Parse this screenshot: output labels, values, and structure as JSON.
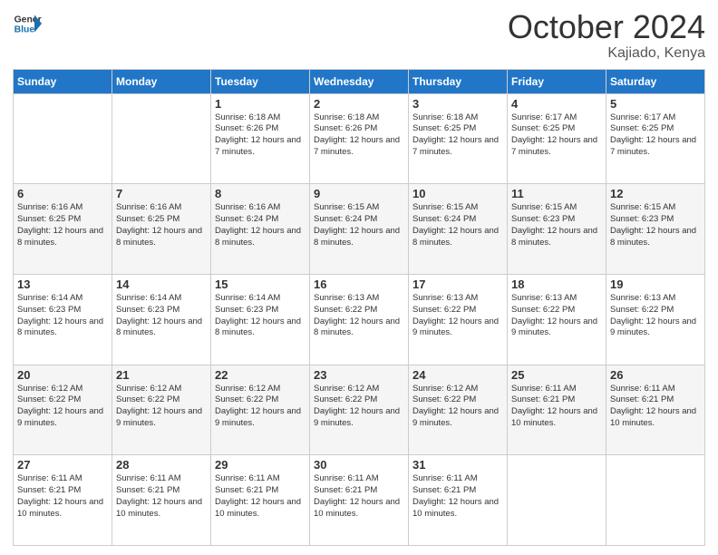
{
  "header": {
    "logo_line1": "General",
    "logo_line2": "Blue",
    "month": "October 2024",
    "location": "Kajiado, Kenya"
  },
  "weekdays": [
    "Sunday",
    "Monday",
    "Tuesday",
    "Wednesday",
    "Thursday",
    "Friday",
    "Saturday"
  ],
  "weeks": [
    [
      {
        "day": "",
        "info": ""
      },
      {
        "day": "",
        "info": ""
      },
      {
        "day": "1",
        "info": "Sunrise: 6:18 AM\nSunset: 6:26 PM\nDaylight: 12 hours and 7 minutes."
      },
      {
        "day": "2",
        "info": "Sunrise: 6:18 AM\nSunset: 6:26 PM\nDaylight: 12 hours and 7 minutes."
      },
      {
        "day": "3",
        "info": "Sunrise: 6:18 AM\nSunset: 6:25 PM\nDaylight: 12 hours and 7 minutes."
      },
      {
        "day": "4",
        "info": "Sunrise: 6:17 AM\nSunset: 6:25 PM\nDaylight: 12 hours and 7 minutes."
      },
      {
        "day": "5",
        "info": "Sunrise: 6:17 AM\nSunset: 6:25 PM\nDaylight: 12 hours and 7 minutes."
      }
    ],
    [
      {
        "day": "6",
        "info": "Sunrise: 6:16 AM\nSunset: 6:25 PM\nDaylight: 12 hours and 8 minutes."
      },
      {
        "day": "7",
        "info": "Sunrise: 6:16 AM\nSunset: 6:25 PM\nDaylight: 12 hours and 8 minutes."
      },
      {
        "day": "8",
        "info": "Sunrise: 6:16 AM\nSunset: 6:24 PM\nDaylight: 12 hours and 8 minutes."
      },
      {
        "day": "9",
        "info": "Sunrise: 6:15 AM\nSunset: 6:24 PM\nDaylight: 12 hours and 8 minutes."
      },
      {
        "day": "10",
        "info": "Sunrise: 6:15 AM\nSunset: 6:24 PM\nDaylight: 12 hours and 8 minutes."
      },
      {
        "day": "11",
        "info": "Sunrise: 6:15 AM\nSunset: 6:23 PM\nDaylight: 12 hours and 8 minutes."
      },
      {
        "day": "12",
        "info": "Sunrise: 6:15 AM\nSunset: 6:23 PM\nDaylight: 12 hours and 8 minutes."
      }
    ],
    [
      {
        "day": "13",
        "info": "Sunrise: 6:14 AM\nSunset: 6:23 PM\nDaylight: 12 hours and 8 minutes."
      },
      {
        "day": "14",
        "info": "Sunrise: 6:14 AM\nSunset: 6:23 PM\nDaylight: 12 hours and 8 minutes."
      },
      {
        "day": "15",
        "info": "Sunrise: 6:14 AM\nSunset: 6:23 PM\nDaylight: 12 hours and 8 minutes."
      },
      {
        "day": "16",
        "info": "Sunrise: 6:13 AM\nSunset: 6:22 PM\nDaylight: 12 hours and 8 minutes."
      },
      {
        "day": "17",
        "info": "Sunrise: 6:13 AM\nSunset: 6:22 PM\nDaylight: 12 hours and 9 minutes."
      },
      {
        "day": "18",
        "info": "Sunrise: 6:13 AM\nSunset: 6:22 PM\nDaylight: 12 hours and 9 minutes."
      },
      {
        "day": "19",
        "info": "Sunrise: 6:13 AM\nSunset: 6:22 PM\nDaylight: 12 hours and 9 minutes."
      }
    ],
    [
      {
        "day": "20",
        "info": "Sunrise: 6:12 AM\nSunset: 6:22 PM\nDaylight: 12 hours and 9 minutes."
      },
      {
        "day": "21",
        "info": "Sunrise: 6:12 AM\nSunset: 6:22 PM\nDaylight: 12 hours and 9 minutes."
      },
      {
        "day": "22",
        "info": "Sunrise: 6:12 AM\nSunset: 6:22 PM\nDaylight: 12 hours and 9 minutes."
      },
      {
        "day": "23",
        "info": "Sunrise: 6:12 AM\nSunset: 6:22 PM\nDaylight: 12 hours and 9 minutes."
      },
      {
        "day": "24",
        "info": "Sunrise: 6:12 AM\nSunset: 6:22 PM\nDaylight: 12 hours and 9 minutes."
      },
      {
        "day": "25",
        "info": "Sunrise: 6:11 AM\nSunset: 6:21 PM\nDaylight: 12 hours and 10 minutes."
      },
      {
        "day": "26",
        "info": "Sunrise: 6:11 AM\nSunset: 6:21 PM\nDaylight: 12 hours and 10 minutes."
      }
    ],
    [
      {
        "day": "27",
        "info": "Sunrise: 6:11 AM\nSunset: 6:21 PM\nDaylight: 12 hours and 10 minutes."
      },
      {
        "day": "28",
        "info": "Sunrise: 6:11 AM\nSunset: 6:21 PM\nDaylight: 12 hours and 10 minutes."
      },
      {
        "day": "29",
        "info": "Sunrise: 6:11 AM\nSunset: 6:21 PM\nDaylight: 12 hours and 10 minutes."
      },
      {
        "day": "30",
        "info": "Sunrise: 6:11 AM\nSunset: 6:21 PM\nDaylight: 12 hours and 10 minutes."
      },
      {
        "day": "31",
        "info": "Sunrise: 6:11 AM\nSunset: 6:21 PM\nDaylight: 12 hours and 10 minutes."
      },
      {
        "day": "",
        "info": ""
      },
      {
        "day": "",
        "info": ""
      }
    ]
  ]
}
